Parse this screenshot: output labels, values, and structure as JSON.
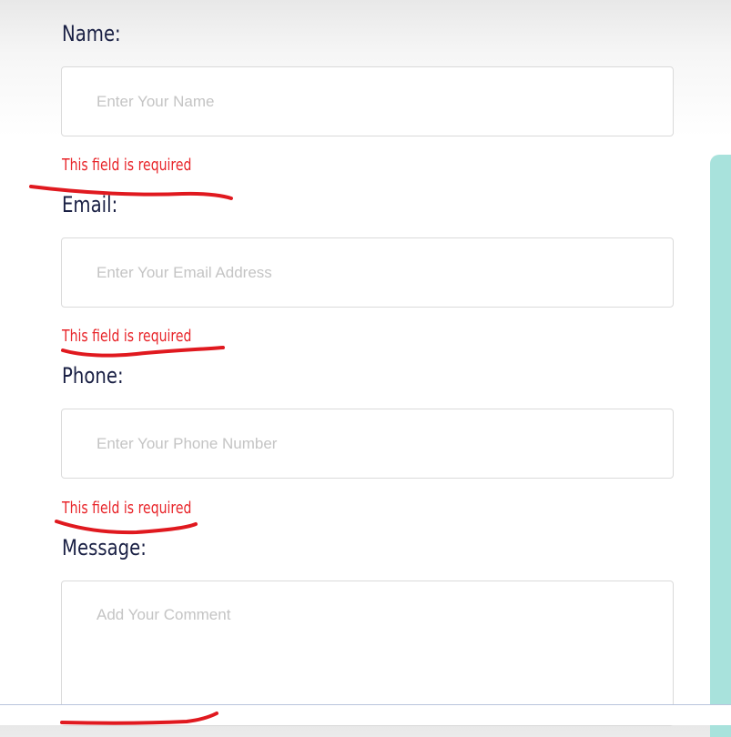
{
  "form": {
    "name": {
      "label": "Name:",
      "placeholder": "Enter Your Name",
      "value": "",
      "error": "This field is required"
    },
    "email": {
      "label": "Email:",
      "placeholder": "Enter Your Email Address",
      "value": "",
      "error": "This field is required"
    },
    "phone": {
      "label": "Phone:",
      "placeholder": "Enter Your Phone Number",
      "value": "",
      "error": "This field is required"
    },
    "message": {
      "label": "Message:",
      "placeholder": "Add Your Comment",
      "value": ""
    }
  },
  "colors": {
    "label": "#1a2044",
    "error": "#e8252a",
    "annotation": "#e0191f",
    "field_border": "#dadada",
    "placeholder": "#c4c4c4",
    "side_panel": "#a8e2dc"
  }
}
